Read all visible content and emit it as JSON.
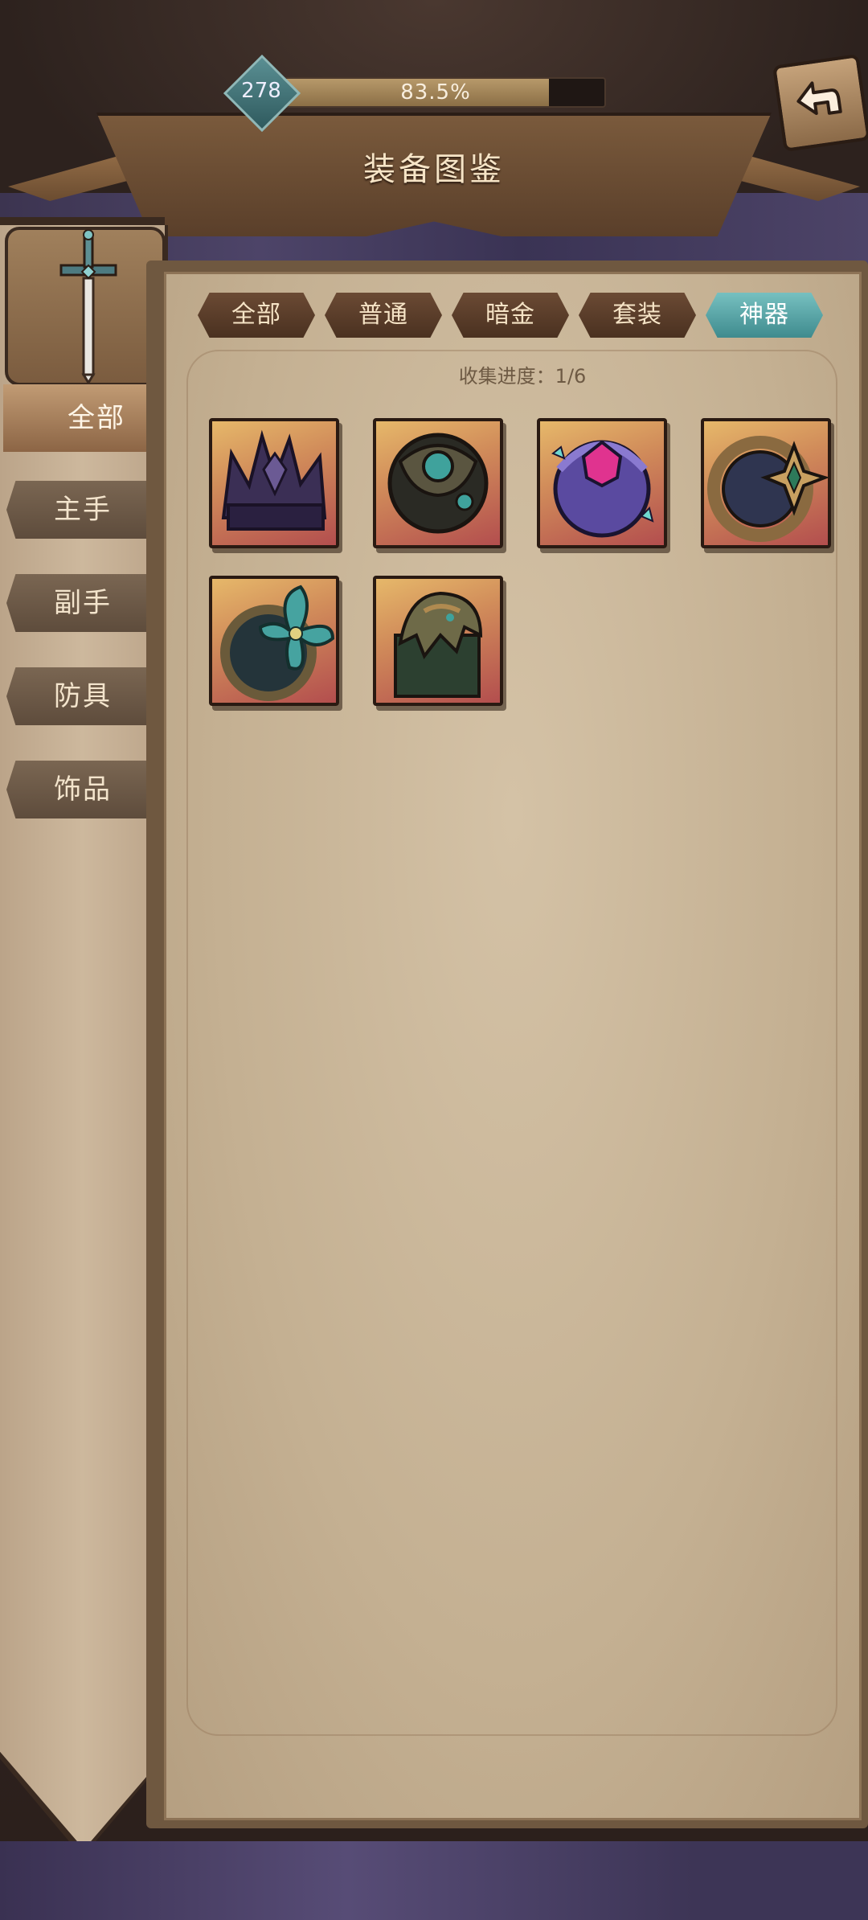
{
  "header": {
    "title": "装备图鉴",
    "level": "278",
    "progress_text": "83.5%",
    "progress_value": 0.835
  },
  "sidebar": {
    "items": [
      {
        "label": "全部",
        "active": true
      },
      {
        "label": "主手",
        "active": false
      },
      {
        "label": "副手",
        "active": false
      },
      {
        "label": "防具",
        "active": false
      },
      {
        "label": "饰品",
        "active": false
      }
    ]
  },
  "category_tabs": [
    {
      "label": "全部",
      "active": false
    },
    {
      "label": "普通",
      "active": false
    },
    {
      "label": "暗金",
      "active": false
    },
    {
      "label": "套装",
      "active": false
    },
    {
      "label": "神器",
      "active": true
    }
  ],
  "collection": {
    "progress_label": "收集进度：1/6"
  },
  "items": [
    {
      "icon": "dark-crown-icon",
      "main": "#3b2f55",
      "accent": "#6b5a94"
    },
    {
      "icon": "teal-orb-ring-icon",
      "main": "#3c4a3e",
      "accent": "#3fa29c"
    },
    {
      "icon": "crimson-gem-orb-icon",
      "main": "#5a4aa0",
      "accent": "#e0338f"
    },
    {
      "icon": "star-gem-ring-icon",
      "main": "#2f3550",
      "accent": "#c8a060"
    },
    {
      "icon": "teal-flower-ring-icon",
      "main": "#2c5a5a",
      "accent": "#46a3a0"
    },
    {
      "icon": "dragon-idol-icon",
      "main": "#3f5040",
      "accent": "#b08a50"
    }
  ],
  "colors": {
    "active_tab": "#5aa6a8",
    "parchment": "#c8b496",
    "wood": "#5a3f2a"
  }
}
